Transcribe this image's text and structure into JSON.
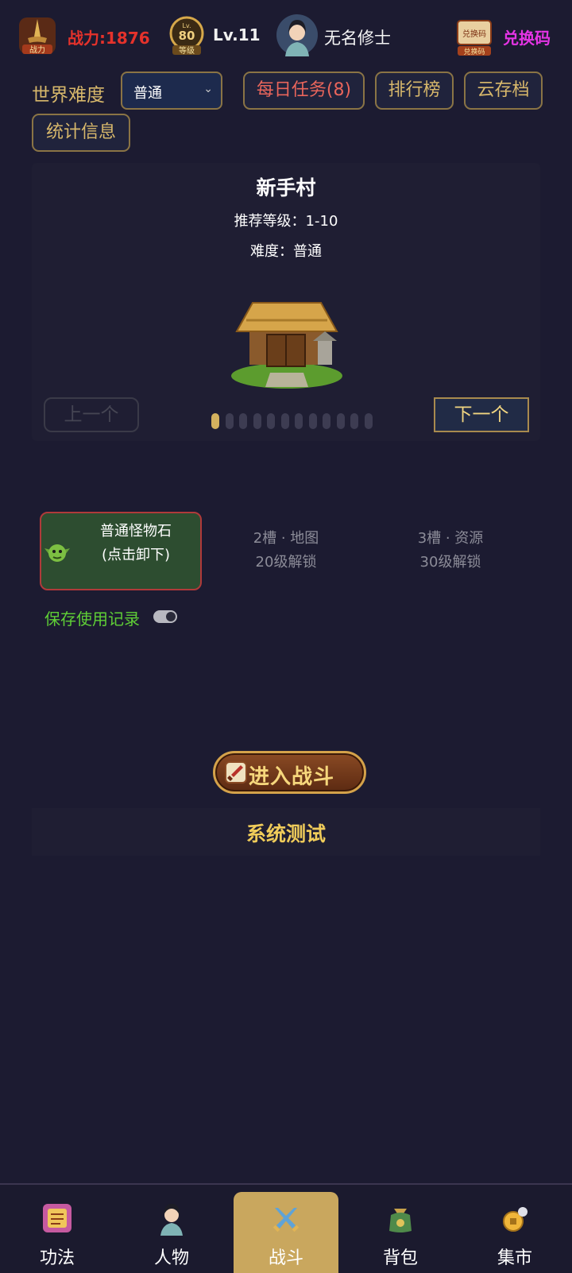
{
  "header": {
    "power_label": "战力:1876",
    "power_icon_text": "战力",
    "level_badge_text": "等级",
    "level_badge_num": "80",
    "level_text": "Lv.11",
    "player_name": "无名修士",
    "redeem_label": "兑换码",
    "redeem_icon_text": "兑换码"
  },
  "controls": {
    "world_difficulty_label": "世界难度",
    "difficulty_selected": "普通",
    "daily_tasks": "每日任务(8)",
    "leaderboard": "排行榜",
    "cloud_save": "云存档",
    "statistics": "统计信息"
  },
  "map": {
    "name": "新手村",
    "recommended_level": "推荐等级：1-10",
    "difficulty": "难度：普通",
    "prev_label": "上一个",
    "next_label": "下一个",
    "page_count": 12,
    "current_page": 1
  },
  "slots": {
    "slot1_line1": "普通怪物石",
    "slot1_line2": "(点击卸下)",
    "slot2_line1": "2槽 · 地图",
    "slot2_line2": "20级解锁",
    "slot3_line1": "3槽 · 资源",
    "slot3_line2": "30级解锁"
  },
  "save_record_label": "保存使用记录",
  "save_record_on": true,
  "battle_label": "进入战斗",
  "system_test_label": "系统测试",
  "bottom_nav": [
    {
      "label": "功法",
      "icon": "scroll-icon"
    },
    {
      "label": "人物",
      "icon": "character-icon"
    },
    {
      "label": "战斗",
      "icon": "crossed-swords-icon",
      "active": true
    },
    {
      "label": "背包",
      "icon": "bag-icon"
    },
    {
      "label": "集市",
      "icon": "market-icon"
    }
  ],
  "colors": {
    "background": "#1c1b31",
    "gold": "#d8b86b",
    "power_red": "#e5322b",
    "redeem_magenta": "#e534e5",
    "slot_green": "#2d4d30",
    "save_green": "#5fcf36"
  }
}
